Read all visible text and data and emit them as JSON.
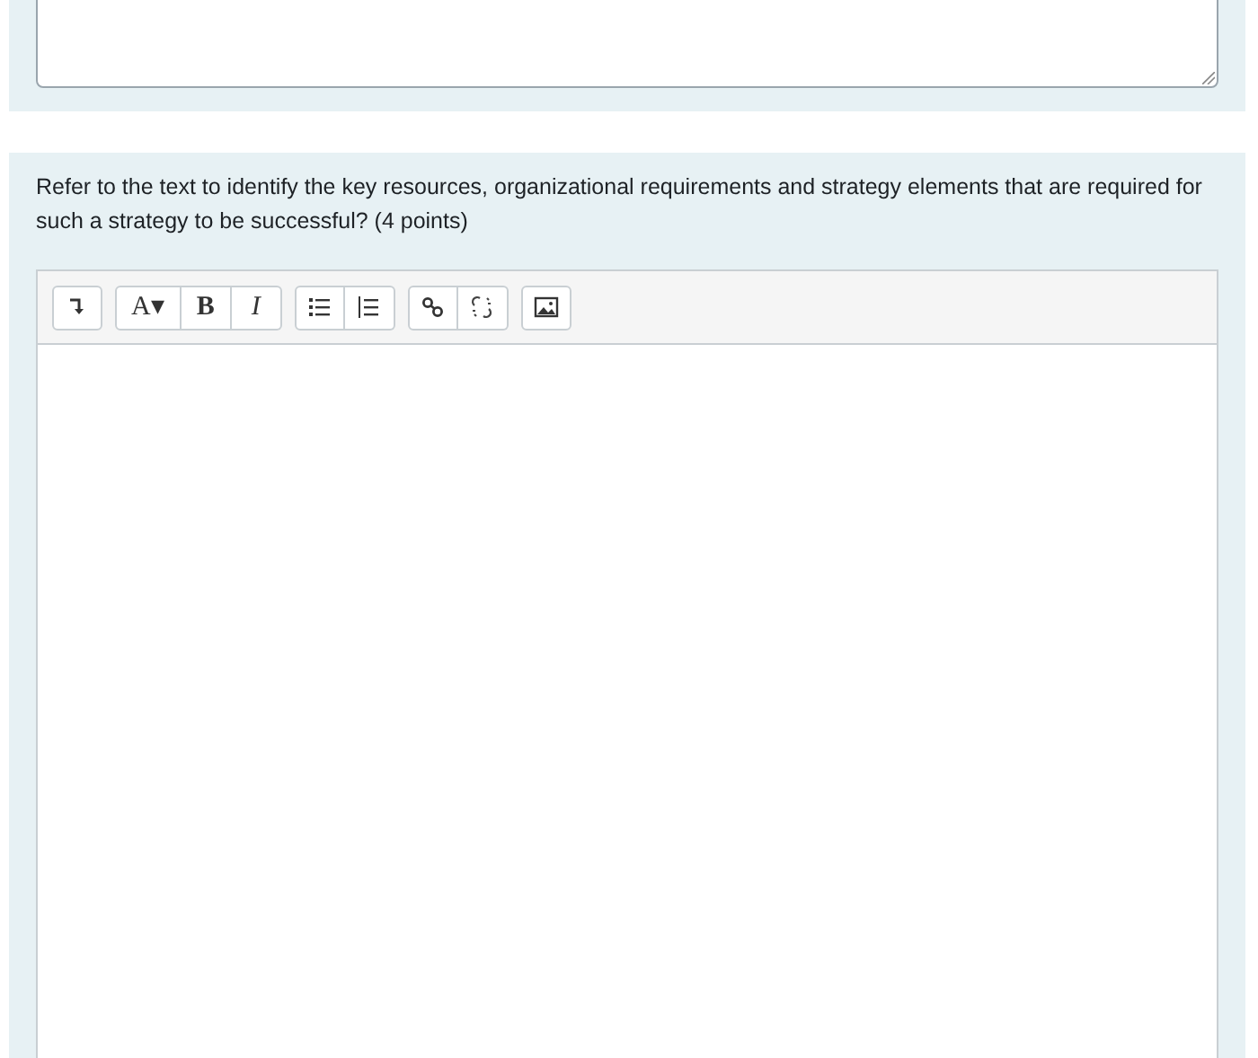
{
  "question": {
    "text": "Refer to the text to identify the key resources, organizational requirements and strategy elements that are required for such a strategy to be successful? (4 points)"
  },
  "toolbar": [
    {
      "buttons": [
        {
          "kind": "collapse"
        }
      ]
    },
    {
      "buttons": [
        {
          "kind": "font",
          "label": "A▾"
        },
        {
          "kind": "bold",
          "label": "B"
        },
        {
          "kind": "italic",
          "label": "I"
        }
      ]
    },
    {
      "buttons": [
        {
          "kind": "bullets"
        },
        {
          "kind": "numbers"
        }
      ]
    },
    {
      "buttons": [
        {
          "kind": "link"
        },
        {
          "kind": "unlink"
        }
      ]
    },
    {
      "buttons": [
        {
          "kind": "image"
        }
      ]
    }
  ]
}
